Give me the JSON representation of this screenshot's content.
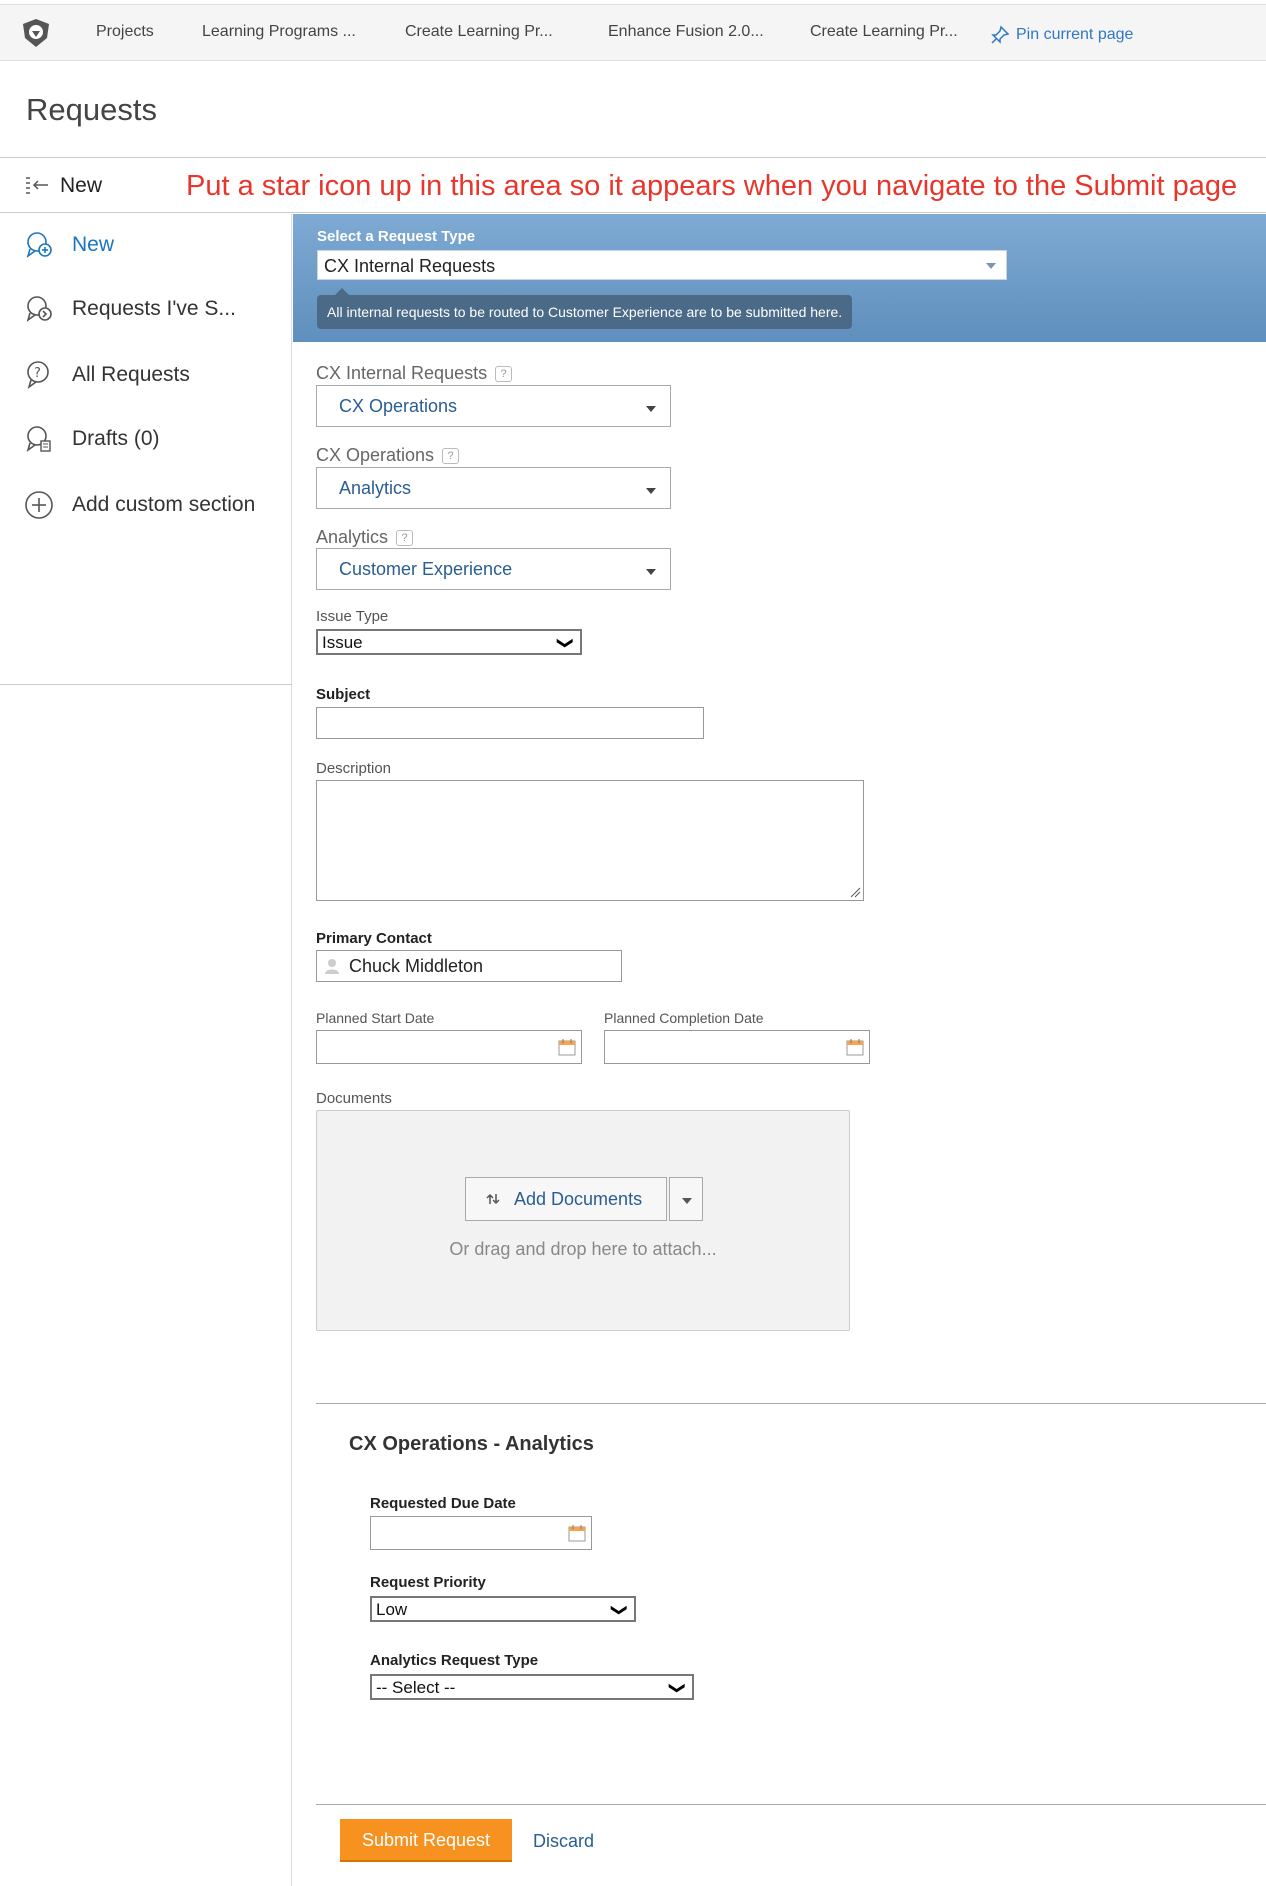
{
  "topnav": {
    "tabs": [
      "Projects",
      "Learning Programs ...",
      "Create Learning Pr...",
      "Enhance Fusion 2.0...",
      "Create Learning Pr..."
    ],
    "pin_label": "Pin current page"
  },
  "page": {
    "title": "Requests"
  },
  "subhead": {
    "label": "New"
  },
  "annotation": "Put a star icon up in this area so it appears when you navigate to the Submit page",
  "sidebar": {
    "items": [
      {
        "label": "New",
        "icon": "new-request-icon"
      },
      {
        "label": "Requests I've S...",
        "icon": "submitted-requests-icon"
      },
      {
        "label": "All Requests",
        "icon": "all-requests-icon"
      },
      {
        "label": "Drafts (0)",
        "icon": "drafts-icon"
      }
    ],
    "add_label": "Add custom section"
  },
  "banner": {
    "label": "Select a Request Type",
    "value": "CX Internal Requests",
    "tooltip": "All internal requests to be routed to Customer Experience are to be submitted here."
  },
  "form": {
    "cascade": [
      {
        "label": "CX Internal Requests",
        "value": "CX Operations"
      },
      {
        "label": "CX Operations",
        "value": "Analytics"
      },
      {
        "label": "Analytics",
        "value": "Customer Experience"
      }
    ],
    "help_mark": "?",
    "issue_type": {
      "label": "Issue Type",
      "value": "Issue"
    },
    "subject": {
      "label": "Subject",
      "value": ""
    },
    "description": {
      "label": "Description",
      "value": ""
    },
    "primary_contact": {
      "label": "Primary Contact",
      "value": "Chuck Middleton"
    },
    "planned_start": {
      "label": "Planned Start Date"
    },
    "planned_completion": {
      "label": "Planned Completion Date"
    },
    "documents": {
      "label": "Documents",
      "add_label": "Add Documents",
      "drop_text": "Or drag and drop here to attach..."
    }
  },
  "section": {
    "title": "CX Operations - Analytics",
    "due_date": {
      "label": "Requested Due Date"
    },
    "priority": {
      "label": "Request Priority",
      "value": "Low"
    },
    "analytics_type": {
      "label": "Analytics Request Type",
      "value": "-- Select --"
    }
  },
  "actions": {
    "submit": "Submit Request",
    "discard": "Discard"
  },
  "colors": {
    "accent_blue": "#1b76c1",
    "submit_orange": "#f7911f",
    "annotation_red": "#e8362d",
    "banner_blue": "#6f9cc8"
  }
}
